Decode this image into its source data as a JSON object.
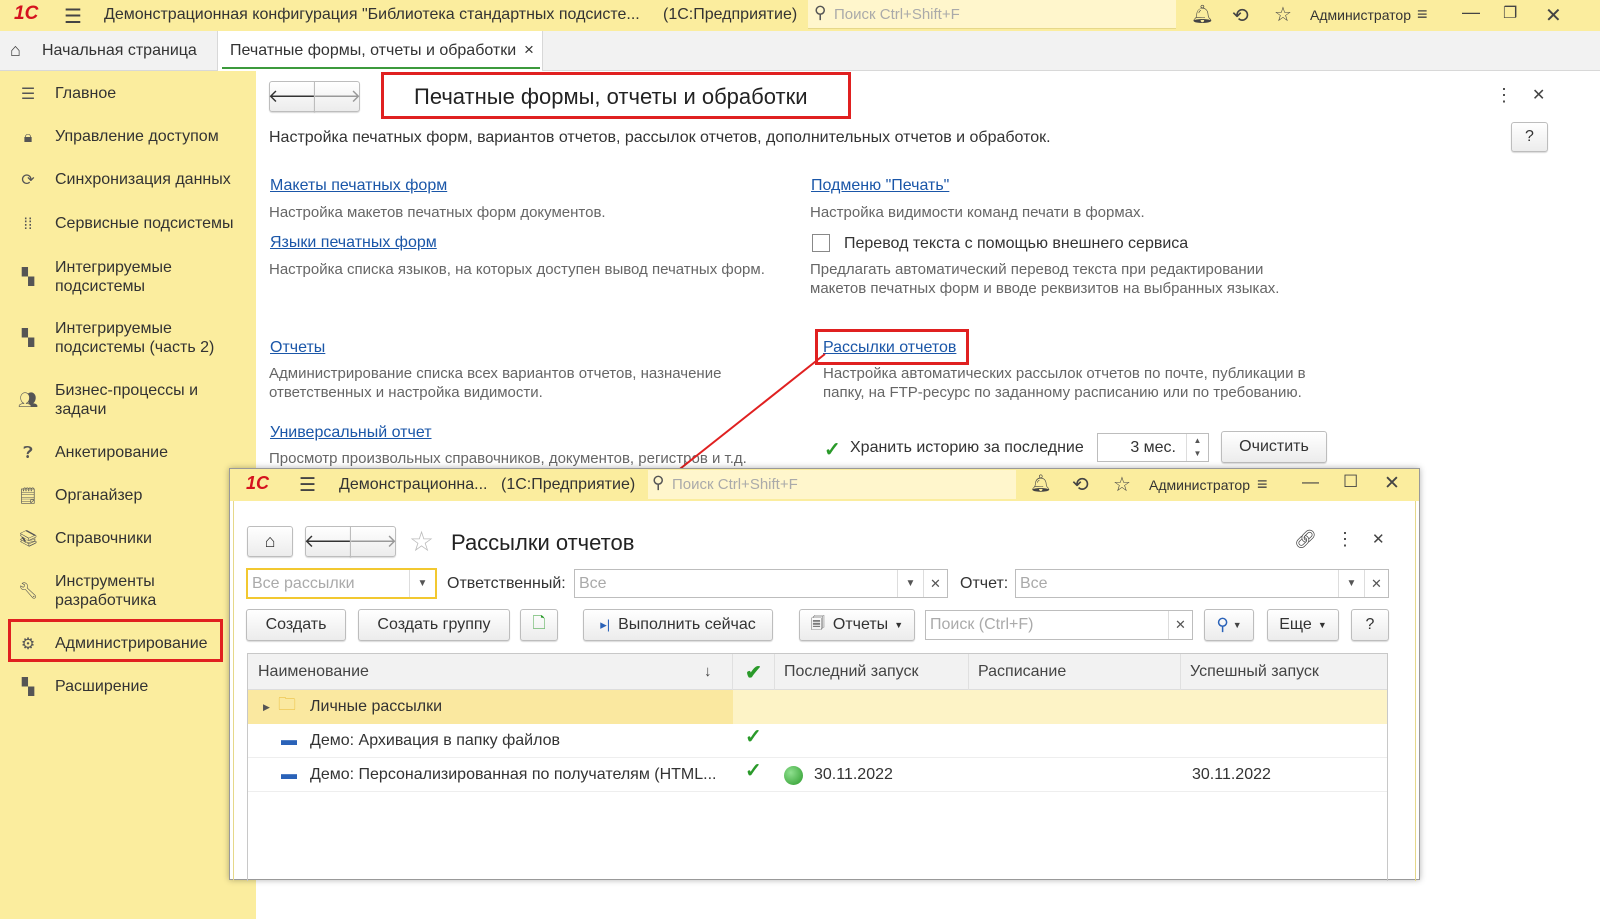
{
  "topbar": {
    "logo": "1С",
    "title": "Демонстрационная конфигурация \"Библиотека стандартных подсисте...",
    "platform": "(1С:Предприятие)",
    "search_placeholder": "Поиск Ctrl+Shift+F",
    "user": "Администратор"
  },
  "tabs": {
    "home": "Начальная страница",
    "active": "Печатные формы, отчеты и обработки",
    "close": "×"
  },
  "sidebar": {
    "items": [
      {
        "label": "Главное",
        "icon": "menu-icon"
      },
      {
        "label": "Управление доступом",
        "icon": "lock-icon"
      },
      {
        "label": "Синхронизация данных",
        "icon": "sync-icon"
      },
      {
        "label": "Сервисные подсистемы",
        "icon": "grid-icon"
      },
      {
        "label": "Интегрируемые подсистемы",
        "icon": "blocks-icon"
      },
      {
        "label": "Интегрируемые подсистемы (часть 2)",
        "icon": "blocks-icon"
      },
      {
        "label": "Бизнес-процессы и задачи",
        "icon": "users-icon"
      },
      {
        "label": "Анкетирование",
        "icon": "question-icon"
      },
      {
        "label": "Органайзер",
        "icon": "notebook-icon"
      },
      {
        "label": "Справочники",
        "icon": "books-icon"
      },
      {
        "label": "Инструменты разработчика",
        "icon": "wrench-icon"
      },
      {
        "label": "Администрирование",
        "icon": "gear-icon"
      },
      {
        "label": "Расширение",
        "icon": "blocks-icon"
      }
    ]
  },
  "main": {
    "title": "Печатные формы, отчеты и обработки",
    "subtitle": "Настройка печатных форм, вариантов отчетов, рассылок отчетов, дополнительных отчетов и обработок.",
    "help": "?",
    "left": [
      {
        "link": "Макеты печатных форм",
        "desc": "Настройка макетов печатных форм документов."
      },
      {
        "link": "Языки печатных форм",
        "desc": "Настройка списка языков, на которых доступен вывод печатных форм."
      },
      {
        "link": "Отчеты",
        "desc": "Администрирование списка всех вариантов отчетов, назначение ответственных и настройка видимости."
      },
      {
        "link": "Универсальный отчет",
        "desc": "Просмотр произвольных справочников, документов, регистров и т.д."
      }
    ],
    "right": {
      "print_link": "Подменю \"Печать\"",
      "print_desc": "Настройка видимости команд печати в формах.",
      "translate_label": "Перевод текста с помощью внешнего сервиса",
      "translate_desc": "Предлагать автоматический перевод текста при редактировании макетов печатных форм и вводе реквизитов на выбранных языках.",
      "mailing_link": "Рассылки отчетов",
      "mailing_desc": "Настройка автоматических рассылок отчетов по почте, публикации в папку, на FTP-ресурс по заданному расписанию или по требованию.",
      "history_label": "Хранить историю за последние",
      "history_value": "3 мес.",
      "clear_button": "Очистить"
    }
  },
  "popup": {
    "logo": "1С",
    "title": "Демонстрационна...",
    "platform": "(1С:Предприятие)",
    "search_placeholder": "Поиск Ctrl+Shift+F",
    "user": "Администратор",
    "form_title": "Рассылки отчетов",
    "filter_all_placeholder": "Все рассылки",
    "responsible_label": "Ответственный:",
    "responsible_placeholder": "Все",
    "report_label": "Отчет:",
    "report_placeholder": "Все",
    "buttons": {
      "create": "Создать",
      "create_group": "Создать группу",
      "run_now": "Выполнить сейчас",
      "reports": "Отчеты",
      "more": "Еще",
      "help": "?"
    },
    "search_placeholder2": "Поиск (Ctrl+F)",
    "columns": [
      "Наименование",
      "Последний запуск",
      "Расписание",
      "Успешный запуск"
    ],
    "sort_arrow": "↓",
    "rows": [
      {
        "name": "Личные рассылки",
        "check": false,
        "last": "",
        "schedule": "",
        "success": ""
      },
      {
        "name": "Демо: Архивация в папку файлов",
        "check": true,
        "last": "",
        "schedule": "",
        "success": ""
      },
      {
        "name": "Демо: Персонализированная по получателям (HTML...",
        "check": true,
        "last": "30.11.2022",
        "schedule": "",
        "success": "30.11.2022"
      }
    ]
  },
  "colors": {
    "accent": "#fbed9e",
    "highlight": "#e02020",
    "link": "#1a56a8",
    "success": "#2a9a2a"
  }
}
